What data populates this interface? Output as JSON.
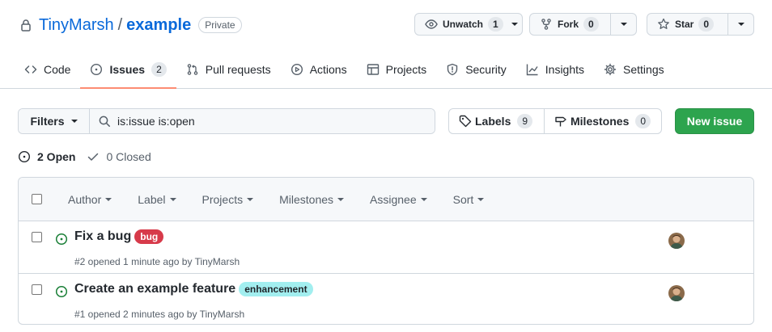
{
  "repo": {
    "owner": "TinyMarsh",
    "separator": "/",
    "name": "example",
    "visibility": "Private"
  },
  "actions": {
    "watch": {
      "label": "Unwatch",
      "count": "1"
    },
    "fork": {
      "label": "Fork",
      "count": "0"
    },
    "star": {
      "label": "Star",
      "count": "0"
    }
  },
  "tabs": [
    {
      "label": "Code",
      "icon": "code-icon"
    },
    {
      "label": "Issues",
      "icon": "issue-opened-icon",
      "count": "2",
      "active": true
    },
    {
      "label": "Pull requests",
      "icon": "git-pull-request-icon"
    },
    {
      "label": "Actions",
      "icon": "play-icon"
    },
    {
      "label": "Projects",
      "icon": "table-icon"
    },
    {
      "label": "Security",
      "icon": "shield-icon"
    },
    {
      "label": "Insights",
      "icon": "graph-icon"
    },
    {
      "label": "Settings",
      "icon": "gear-icon"
    }
  ],
  "toolbar": {
    "filters_label": "Filters",
    "search_value": "is:issue is:open",
    "labels": {
      "label": "Labels",
      "count": "9"
    },
    "milestones": {
      "label": "Milestones",
      "count": "0"
    },
    "new_issue_label": "New issue"
  },
  "states": {
    "open": "2 Open",
    "closed": "0 Closed"
  },
  "list_header": {
    "filters": [
      "Author",
      "Label",
      "Projects",
      "Milestones",
      "Assignee",
      "Sort"
    ]
  },
  "issues": [
    {
      "title": "Fix a bug",
      "label": "bug",
      "label_bg": "#d73a4a",
      "label_fg": "#ffffff",
      "meta": "#2 opened 1 minute ago by TinyMarsh"
    },
    {
      "title": "Create an example feature",
      "label": "enhancement",
      "label_bg": "#a2eeef",
      "label_fg": "#1f2328",
      "meta": "#1 opened 2 minutes ago by TinyMarsh"
    }
  ],
  "colors": {
    "link": "#0969da",
    "primary_button": "#2da44e",
    "open_icon": "#1a7f37",
    "active_tab_underline": "#fd8c73"
  }
}
